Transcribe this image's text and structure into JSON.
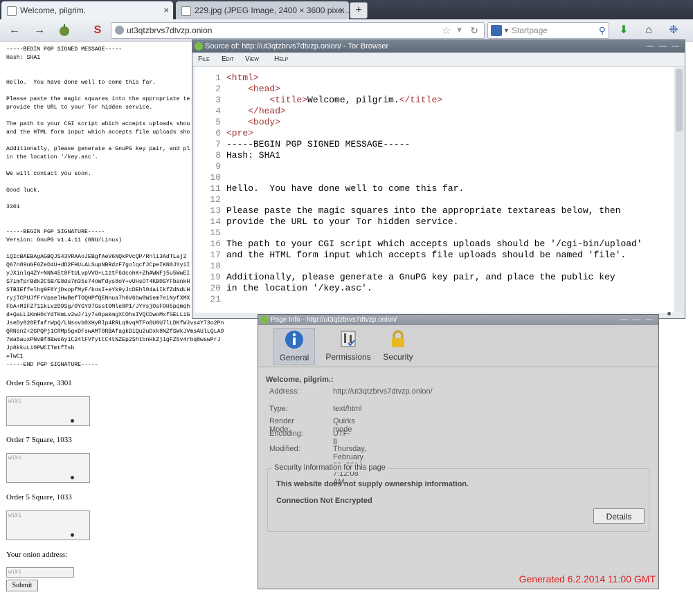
{
  "tabs": [
    {
      "title": "Welcome, pilgrim.",
      "close": "×"
    },
    {
      "title": "229.jpg (JPEG Image, 2400 × 3600 pixe...",
      "close": "×"
    }
  ],
  "new_tab_label": "+",
  "nav": {
    "url": "ut3qtzbrvs7dtvzp.onion",
    "search_placeholder": "Startpage"
  },
  "page": {
    "pgp_text": "-----BEGIN PGP SIGNED MESSAGE-----\nHash: SHA1\n\n\nHello.  You have done well to come this far.\n\nPlease paste the magic squares into the appropriate te\nprovide the URL to your Tor hidden service.\n\nThe path to your CGI script which accepts uploads shou\nand the HTML form input which accepts file uploads sho\n\nAdditionally, please generate a GnuPG key pair, and pl\nin the location '/key.asc'.\n\nWe will contact you soon.\n\nGood luck.\n\n3301\n\n\n-----BEGIN PGP SIGNATURE-----\nVersion: GnuPG v1.4.11 (GNU/Linux)\n\niQIcBAEBAgAGBQJS43VRAAoJEBgfAeV6NQkPVcQP/Rnli3AdTLaj2\nQ67n89uGF6ZeD4U+dD2FHULALSupNBRdzF7golqcfJCpeIKN0JYyiI\nyJXinlq4ZY+NNN45t8FtULvpVVO+L1ztF6dcohK+ZhAWWFj5u5WwEI\nS7imfprBdk2C5B/E8ds7m35s74oWfdys8oY+vUHsOT4KB0SYFbankH\nSTBIEffelhg9F8YjDsopfMyF/kosI+eYk9yJcDEhl04aiIkfZdNdLH\nryjTCPUJfFrVpaelHwBefTOQHPfQENnua7h6V6bw8Wiem7eiNyfXMX\nFbA+MIFZ711kLvzD9Sg/0YGY97Gsst0Mle8P1/JYYsjOsFOH5pqmqh\nd+QaLLiKmH0cYdTKmLv2wJ/1y7s0pakmgXCOhsIVQCDwoMxfGELLiG\nJseDy828EfafrWpQ/LNsovb0XHyRlp4RRLq9vqMTFo0U0U7lLDKfWJvs4Y73o2Pn\nQRNsn2+2GPQPj1CRMp5gxDFswAMT0RBAfagkDiQu2uDxk8NZfSWkJVmsAUlLQLA9\n7Wa5auxPNvBf8Bws6y1C24lFVfyttC4tNZEp2ShtbnHkZj1gFZ5v4rbq8wswPrJ\nJp8kkuLi0PWCITmtfTsb\n=TwC1\n-----END PGP SIGNATURE-----",
    "orders": [
      {
        "label": "Order 5 Square, 3301",
        "placeholder": "wiki"
      },
      {
        "label": "Order 7 Square, 1033",
        "placeholder": "wiki"
      },
      {
        "label": "Order 5 Square, 1033",
        "placeholder": "wiki"
      }
    ],
    "onion_label": "Your onion address:",
    "onion_placeholder": "wiki",
    "submit_label": "Submit"
  },
  "source_window": {
    "title": "Source of: http://ut3qtzbrvs7dtvzp.onion/ - Tor Browser",
    "window_controls": "—  —  —",
    "menus": [
      "File",
      "Edit",
      "View",
      "Help"
    ],
    "lines": [
      {
        "n": "1",
        "text": "<html>"
      },
      {
        "n": "2",
        "text": "    <head>"
      },
      {
        "n": "3",
        "text": "        <title>Welcome, pilgrim.</title>"
      },
      {
        "n": "4",
        "text": "    </head>"
      },
      {
        "n": "5",
        "text": "    <body>"
      },
      {
        "n": "6",
        "text": "<pre>"
      },
      {
        "n": "7",
        "text": "-----BEGIN PGP SIGNED MESSAGE-----"
      },
      {
        "n": "8",
        "text": "Hash: SHA1"
      },
      {
        "n": "9",
        "text": ""
      },
      {
        "n": "10",
        "text": ""
      },
      {
        "n": "11",
        "text": "Hello.  You have done well to come this far."
      },
      {
        "n": "12",
        "text": ""
      },
      {
        "n": "13",
        "text": "Please paste the magic squares into the appropriate textareas below, then"
      },
      {
        "n": "14",
        "text": "provide the URL to your Tor hidden service."
      },
      {
        "n": "15",
        "text": ""
      },
      {
        "n": "16",
        "text": "The path to your CGI script which accepts uploads should be '/cgi-bin/upload'"
      },
      {
        "n": "17",
        "text": "and the HTML form input which accepts file uploads should be named 'file'."
      },
      {
        "n": "18",
        "text": ""
      },
      {
        "n": "19",
        "text": "Additionally, please generate a GnuPG key pair, and place the public key"
      },
      {
        "n": "20",
        "text": "in the location '/key.asc'."
      },
      {
        "n": "21",
        "text": ""
      }
    ]
  },
  "info_window": {
    "title": "Page Info - http://ut3qtzbrvs7dtvzp.onion/",
    "window_controls": "—  —  —",
    "tabs": [
      "General",
      "Permissions",
      "Security"
    ],
    "heading": "Welcome, pilgrim.:",
    "rows": [
      {
        "label": "Address:",
        "value": "http://ut3qtzbrvs7dtvzp.onion/"
      },
      {
        "label": "Type:",
        "value": "text/html"
      },
      {
        "label": "Render Mode:",
        "value": "Quirks mode"
      },
      {
        "label": "Encoding:",
        "value": "UTF-8"
      },
      {
        "label": "Modified:",
        "value": "Thursday, February 06, 2014 7:12:08 AM"
      }
    ],
    "security_legend": "Security information for this page",
    "security_lines": [
      "This website does not supply ownership information.",
      "Connection Not Encrypted"
    ],
    "details_label": "Details"
  },
  "overlay": {
    "generated": "Generated 6.2.2014 11:00 GMT"
  },
  "colors": {
    "accent_red": "#e02020",
    "tag_red": "#a03030",
    "chrome_dark": "#2e3541"
  }
}
